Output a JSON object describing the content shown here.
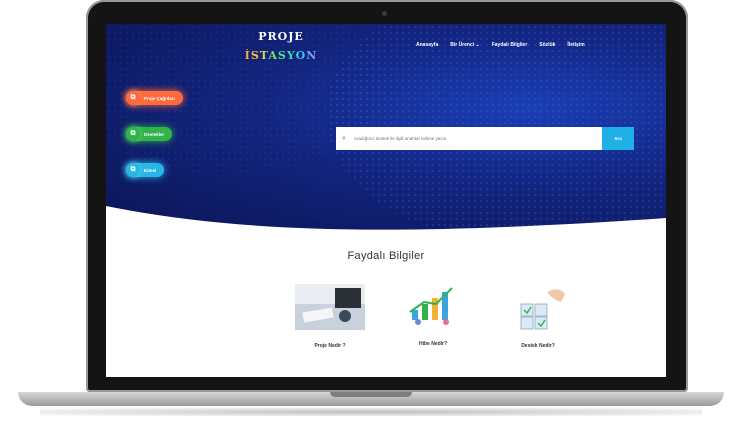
{
  "brand": {
    "line1": "PROJE",
    "line2": "İSTASYON"
  },
  "nav": {
    "items": [
      "Anasayfa",
      "Bir Ürenci ⌄",
      "Faydalı Bilgiler",
      "Sözlük",
      "İletişim"
    ]
  },
  "side_buttons": [
    {
      "label": "Proje Çağrıları",
      "color": "#ff6a3d",
      "icon": "copy-icon"
    },
    {
      "label": "Destekler",
      "color": "#2fb34a",
      "icon": "copy-icon"
    },
    {
      "label": "Kimsi",
      "color": "#29b6e6",
      "icon": "copy-icon"
    }
  ],
  "search": {
    "placeholder": "Aradığınız destek ile ilgili anahtar kelime yazın",
    "button": "Ara"
  },
  "section": {
    "title": "Faydalı Bilgiler"
  },
  "cards": [
    {
      "caption": "Proje Nedir ?"
    },
    {
      "caption": "Hibe Nedir?"
    },
    {
      "caption": "Destek Nedir?"
    }
  ],
  "colors": {
    "hero_dark": "#0b1554",
    "hero_mid": "#1b3fb6",
    "accent": "#1fb1e6"
  }
}
